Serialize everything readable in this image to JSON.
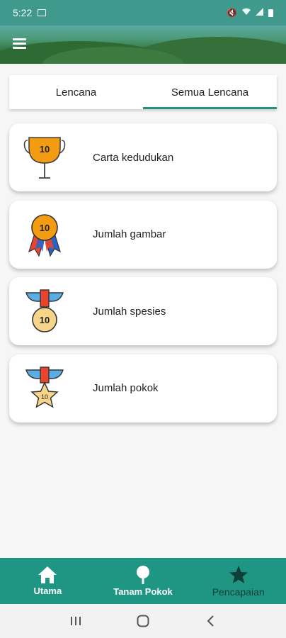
{
  "status_bar": {
    "time": "5:22"
  },
  "tabs": [
    {
      "label": "Lencana",
      "active": false
    },
    {
      "label": "Semua Lencana",
      "active": true
    }
  ],
  "badges": [
    {
      "label": "Carta kedudukan",
      "icon": "trophy-icon",
      "number": "10"
    },
    {
      "label": "Jumlah gambar",
      "icon": "ribbon-medal-icon",
      "number": "10"
    },
    {
      "label": "Jumlah spesies",
      "icon": "medal-icon",
      "number": "10"
    },
    {
      "label": "Jumlah pokok",
      "icon": "star-medal-icon",
      "number": "10"
    }
  ],
  "bottom_nav": [
    {
      "label": "Utama",
      "icon": "home-icon"
    },
    {
      "label": "Tanam Pokok",
      "icon": "tree-icon"
    },
    {
      "label": "Pencapaian",
      "icon": "star-icon",
      "active": true
    }
  ],
  "colors": {
    "accent": "#21937f",
    "nav_bg": "#1f9683",
    "trophy": "#f39c12"
  }
}
